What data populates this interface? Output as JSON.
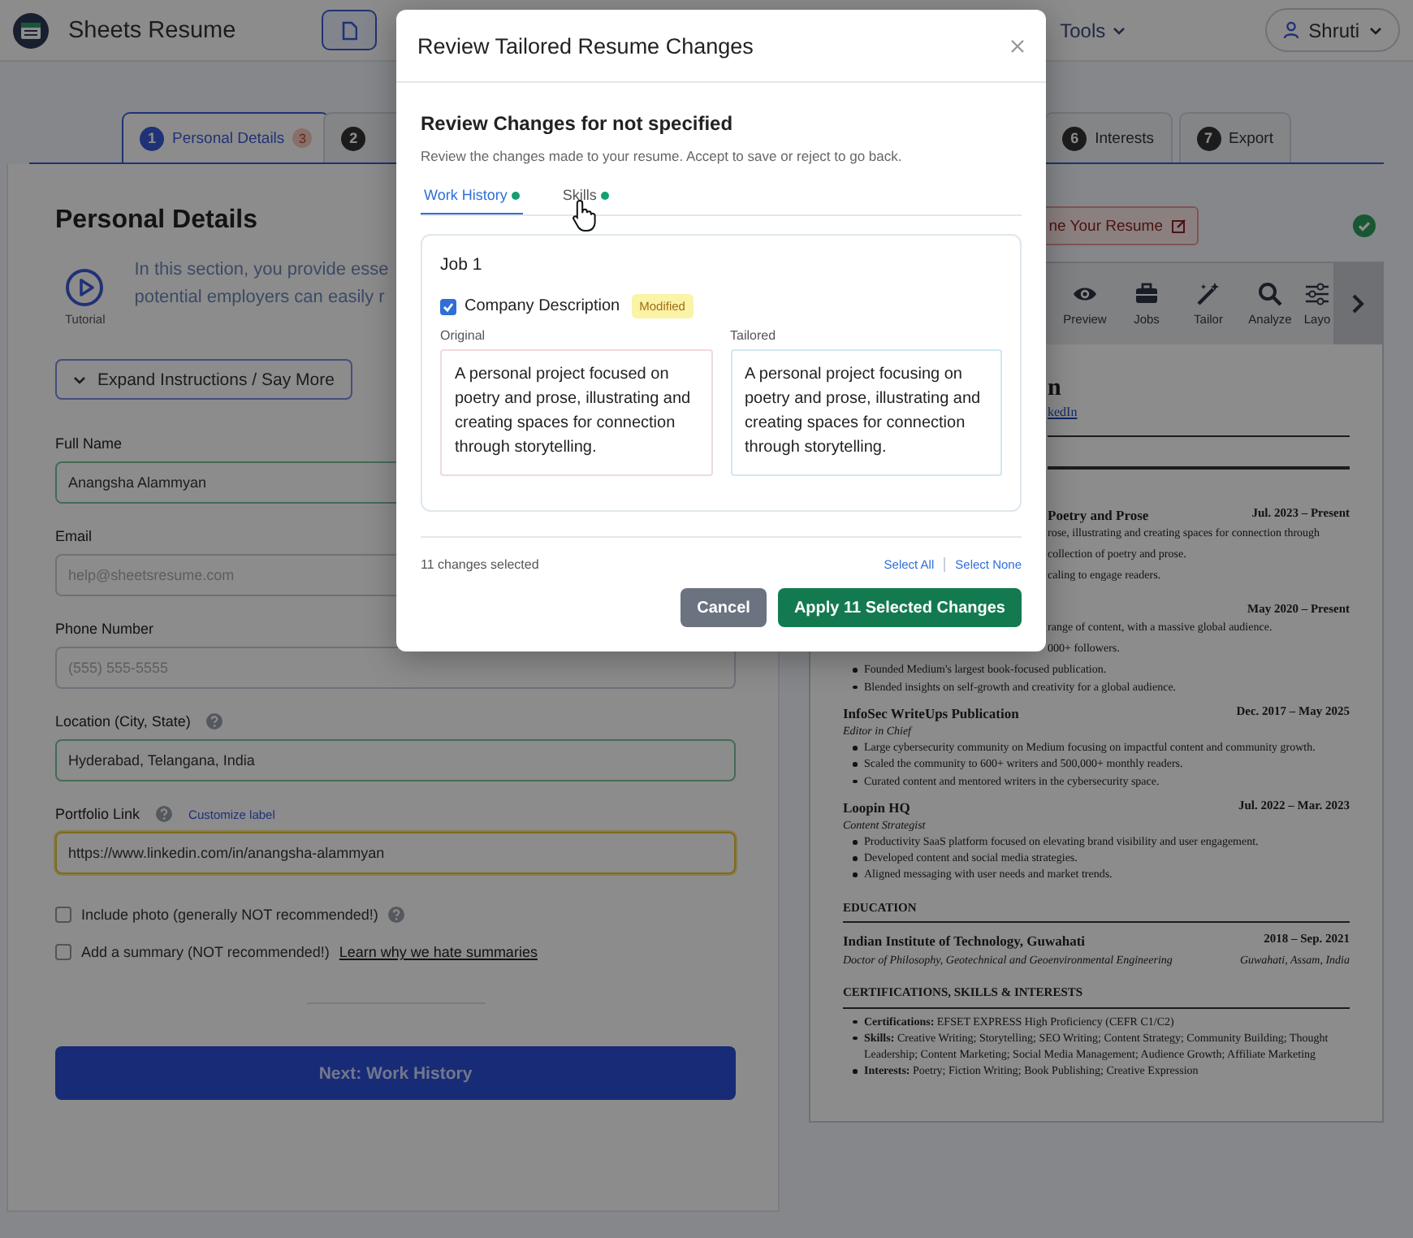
{
  "header": {
    "app_name": "Sheets Resume",
    "menu_label": "Tools",
    "user_name": "Shruti"
  },
  "steps": [
    {
      "number": "1",
      "label": "Personal Details",
      "badge": "3",
      "selected": true
    },
    {
      "number": "2",
      "selected": false
    },
    {
      "number": "6",
      "label": "Interests",
      "selected": false
    },
    {
      "number": "7",
      "label": "Export",
      "selected": false
    }
  ],
  "form": {
    "title": "Personal Details",
    "tutorial_label": "Tutorial",
    "intro_lines": [
      "In this section, you provide esse",
      "potential employers can easily r"
    ],
    "expand_button": "Expand Instructions / Say More",
    "fields": [
      {
        "label": "Full Name",
        "value": "Anangsha Alammyan",
        "kind": "valid"
      },
      {
        "label": "Email",
        "placeholder": "help@sheetsresume.com",
        "kind": "empty"
      },
      {
        "label": "Phone Number",
        "placeholder": "(555) 555-5555",
        "kind": "empty"
      },
      {
        "label": "Location (City, State)",
        "help": true,
        "value": "Hyderabad, Telangana, India",
        "kind": "valid"
      },
      {
        "label": "Portfolio Link",
        "help": true,
        "link": "Customize label",
        "value": "https://www.linkedin.com/in/anangsha-alammyan",
        "kind": "warning"
      }
    ],
    "options": [
      {
        "label": "Include photo (generally NOT recommended!)",
        "checked": false,
        "help": true
      },
      {
        "label": "Add a summary (NOT recommended!)",
        "checked": false,
        "link": "Learn why we hate summaries"
      }
    ],
    "next_button": "Next: Work History"
  },
  "resume_panel": {
    "rename_button": "ne Your Resume",
    "saved": true,
    "tools": [
      {
        "label": "Preview",
        "kind": "eye"
      },
      {
        "label": "Jobs",
        "kind": "briefcase"
      },
      {
        "label": "Tailor",
        "kind": "wand"
      },
      {
        "label": "Analyze",
        "kind": "search"
      },
      {
        "label": "Layo",
        "kind": "sliders"
      }
    ],
    "partial_lines": [
      {
        "kind": "name",
        "text": "n"
      },
      {
        "kind": "link",
        "text": "kedIn"
      },
      {
        "kind": "rule"
      },
      {
        "kind": "rule"
      },
      {
        "kind": "entry",
        "text": "Poetry and Prose",
        "date": "Jul. 2023 – Present"
      },
      {
        "kind": "plain",
        "text": "rose, illustrating and creating spaces for connection through"
      },
      {
        "kind": "plain",
        "text": "collection of poetry and prose."
      },
      {
        "kind": "plain",
        "text": "caling to engage readers."
      },
      {
        "kind": "entry",
        "date": "May 2020 – Present"
      },
      {
        "kind": "plain",
        "text": "range of content, with a massive global audience."
      },
      {
        "kind": "plain",
        "text": "000+ followers."
      }
    ],
    "lines": [
      {
        "kind": "bullet",
        "text": "Founded Medium's largest book-focused publication."
      },
      {
        "kind": "bullet",
        "text": "Blended insights on self-growth and creativity for a global audience."
      },
      {
        "kind": "entry",
        "text": "InfoSec WriteUps Publication",
        "date": "Dec. 2017 – May 2025"
      },
      {
        "kind": "role",
        "text": "Editor in Chief"
      },
      {
        "kind": "bullet",
        "text": "Large cybersecurity community on Medium focusing on impactful content and community growth."
      },
      {
        "kind": "bullet",
        "text": "Scaled the community to 600+ writers and 500,000+ monthly readers."
      },
      {
        "kind": "bullet",
        "text": "Curated content and mentored writers in the cybersecurity space."
      },
      {
        "kind": "entry",
        "text": "Loopin HQ",
        "date": "Jul. 2022 – Mar. 2023"
      },
      {
        "kind": "role",
        "text": "Content Strategist"
      },
      {
        "kind": "bullet",
        "text": "Productivity SaaS platform focused on elevating brand visibility and user engagement."
      },
      {
        "kind": "bullet",
        "text": "Developed content and social media strategies."
      },
      {
        "kind": "bullet",
        "text": "Aligned messaging with user needs and market trends."
      },
      {
        "kind": "section",
        "text": "EDUCATION"
      },
      {
        "kind": "entry",
        "text": "Indian Institute of Technology, Guwahati",
        "date": "2018 – Sep. 2021"
      },
      {
        "kind": "role",
        "text": "Doctor of Philosophy, Geotechnical and Geoenvironmental Engineering",
        "date": "Guwahati, Assam, India"
      },
      {
        "kind": "section",
        "text": "CERTIFICATIONS, SKILLS & INTERESTS"
      },
      {
        "kind": "bullet",
        "text": "**Certifications:** EFSET EXPRESS High Proficiency (CEFR C1/C2)"
      },
      {
        "kind": "bullet",
        "text": "**Skills:** Creative Writing; Storytelling; SEO Writing; Content Strategy; Community Building; Thought Leadership; Content Marketing; Social Media Management; Audience Growth; Affiliate Marketing"
      },
      {
        "kind": "bullet",
        "text": "**Interests:** Poetry; Fiction Writing; Book Publishing; Creative Expression"
      }
    ]
  },
  "modal": {
    "title": "Review Tailored Resume Changes",
    "heading": "Review Changes for not specified",
    "subtitle": "Review the changes made to your resume. Accept to save or reject to go back.",
    "tabs": [
      {
        "label": "Work History",
        "selected": true,
        "has_changes": true
      },
      {
        "label": "Skills",
        "selected": false,
        "has_changes": true
      }
    ],
    "card": {
      "title": "Job 1",
      "change": {
        "label": "Company Description",
        "checked": true,
        "badge": "Modified",
        "original_label": "Original",
        "original": "A personal project focused on poetry and prose, illustrating and creating spaces for connection through storytelling.",
        "tailored_label": "Tailored",
        "tailored": "A personal project focusing on poetry and prose, illustrating and creating spaces for connection through storytelling."
      }
    },
    "count_text": "11 changes selected",
    "select_all": "Select All",
    "select_none": "Select None",
    "cancel_button": "Cancel",
    "apply_button": "Apply 11 Selected Changes"
  }
}
